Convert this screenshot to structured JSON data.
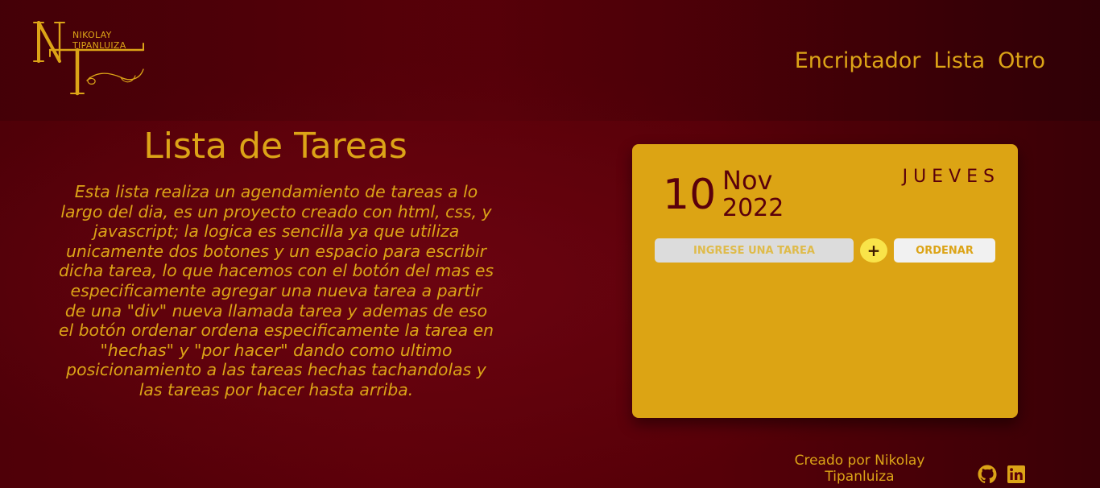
{
  "header": {
    "logo": {
      "monogram": "NT",
      "name_line1": "NIKOLAY",
      "name_line2": "TIPANLUIZA"
    },
    "nav": [
      {
        "label": "Encriptador"
      },
      {
        "label": "Lista"
      },
      {
        "label": "Otro"
      }
    ]
  },
  "main": {
    "title": "Lista de Tareas",
    "description": "Esta lista realiza un agendamiento de tareas a lo largo del dia, es un proyecto creado con html, css, y javascript; la logica es sencilla ya que utiliza unicamente dos botones y un espacio para escribir dicha tarea, lo que hacemos con el botón del mas es especificamente agregar una nueva tarea a partir de una \"div\" nueva llamada tarea y ademas de eso el botón ordenar ordena especificamente la tarea en \"hechas\" y \"por hacer\" dando como ultimo posicionamiento a las tareas hechas tachandolas y las tareas por hacer hasta arriba."
  },
  "card": {
    "day": "10",
    "month": "Nov",
    "year": "2022",
    "weekday": "JUEVES",
    "input": {
      "placeholder": "INGRESE UNA TAREA",
      "value": ""
    },
    "add_label": "+",
    "order_label": "ORDENAR",
    "tasks": []
  },
  "footer": {
    "credit": "Creado por Nikolay Tipanluiza",
    "social": [
      {
        "icon": "github-icon"
      },
      {
        "icon": "linkedin-icon"
      }
    ]
  },
  "colors": {
    "background": "#5c0009",
    "accent": "#dca417",
    "card": "#dca414",
    "card_text": "#5a000b",
    "add_button": "#f9e449"
  }
}
